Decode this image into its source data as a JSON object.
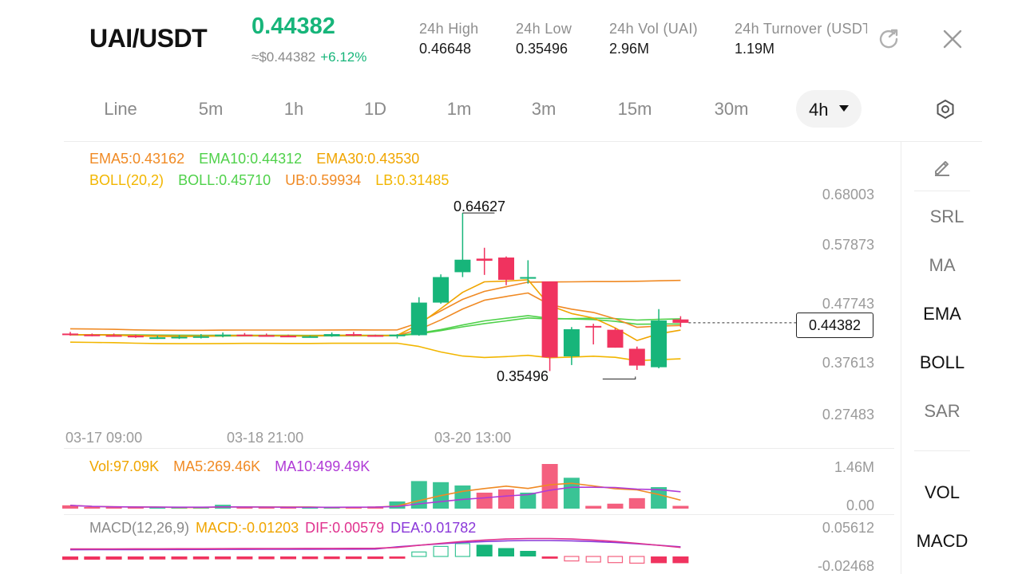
{
  "header": {
    "pair": "UAI/USDT",
    "price": "0.44382",
    "usd_price": "≈$0.44382",
    "change": "+6.12%",
    "stats": [
      {
        "label": "24h  High",
        "value": "0.46648"
      },
      {
        "label": "24h  Low",
        "value": "0.35496"
      },
      {
        "label": "24h  Vol (UAI)",
        "value": "2.96M"
      },
      {
        "label": "24h  Turnover (USDT)",
        "value": "1.19M"
      }
    ],
    "icons": [
      "share-icon",
      "close-icon"
    ]
  },
  "tabs": {
    "items": [
      "Line",
      "5m",
      "1h",
      "1D",
      "1m",
      "3m",
      "15m",
      "30m"
    ],
    "active": "4h",
    "settings_icon": "settings-icon"
  },
  "indicators": {
    "ema": {
      "ema5": "EMA5:0.43162",
      "ema10": "EMA10:0.44312",
      "ema30": "EMA30:0.43530"
    },
    "boll": {
      "name": "BOLL(20,2)",
      "mid": "BOLL:0.45710",
      "ub": "UB:0.59934",
      "lb": "LB:0.31485"
    }
  },
  "price_axis": [
    "0.68003",
    "0.57873",
    "0.47743",
    "0.37613",
    "0.27483"
  ],
  "date_axis": [
    "03-17 09:00",
    "03-18 21:00",
    "03-20 13:00"
  ],
  "annotations": {
    "high": "0.64627",
    "low": "0.35496",
    "current": "0.44382"
  },
  "volume": {
    "vol": "Vol:97.09K",
    "ma5": "MA5:269.46K",
    "ma10": "MA10:499.49K",
    "axis_top": "1.46M",
    "axis_bottom": "0.00"
  },
  "macd": {
    "name": "MACD(12,26,9)",
    "macd": "MACD:-0.01203",
    "dif": "DIF:0.00579",
    "dea": "DEA:0.01782",
    "axis_top": "0.05612",
    "axis_bottom": "-0.02468"
  },
  "side_panel": {
    "edit_icon": "pencil-icon",
    "items": [
      "SRL",
      "MA",
      "EMA",
      "BOLL",
      "SAR"
    ],
    "items2": [
      "VOL",
      "MACD"
    ]
  },
  "colors": {
    "up": "#17b57a",
    "down": "#f0335f",
    "ema5": "#f08a24",
    "ema10": "#4fd14a",
    "ema30": "#f0a500",
    "boll": "#f2b600",
    "vol_ma5": "#f08a24",
    "vol_ma10": "#b03ad6",
    "dif": "#e0338f",
    "dea": "#8a38d9"
  },
  "chart_data": {
    "type": "candlestick",
    "interval": "4h",
    "candles": [
      {
        "o": 0.424,
        "h": 0.427,
        "l": 0.42,
        "c": 0.422
      },
      {
        "o": 0.422,
        "h": 0.424,
        "l": 0.419,
        "c": 0.421
      },
      {
        "o": 0.421,
        "h": 0.424,
        "l": 0.418,
        "c": 0.42
      },
      {
        "o": 0.42,
        "h": 0.422,
        "l": 0.416,
        "c": 0.417
      },
      {
        "o": 0.417,
        "h": 0.42,
        "l": 0.414,
        "c": 0.417
      },
      {
        "o": 0.417,
        "h": 0.421,
        "l": 0.414,
        "c": 0.418
      },
      {
        "o": 0.418,
        "h": 0.423,
        "l": 0.415,
        "c": 0.419
      },
      {
        "o": 0.419,
        "h": 0.426,
        "l": 0.417,
        "c": 0.422
      },
      {
        "o": 0.422,
        "h": 0.425,
        "l": 0.419,
        "c": 0.421
      },
      {
        "o": 0.421,
        "h": 0.424,
        "l": 0.419,
        "c": 0.42
      },
      {
        "o": 0.42,
        "h": 0.422,
        "l": 0.418,
        "c": 0.419
      },
      {
        "o": 0.419,
        "h": 0.42,
        "l": 0.418,
        "c": 0.419
      },
      {
        "o": 0.419,
        "h": 0.426,
        "l": 0.418,
        "c": 0.423
      },
      {
        "o": 0.423,
        "h": 0.427,
        "l": 0.419,
        "c": 0.421
      },
      {
        "o": 0.421,
        "h": 0.422,
        "l": 0.418,
        "c": 0.419
      },
      {
        "o": 0.419,
        "h": 0.423,
        "l": 0.415,
        "c": 0.422
      },
      {
        "o": 0.421,
        "h": 0.491,
        "l": 0.42,
        "c": 0.481
      },
      {
        "o": 0.481,
        "h": 0.533,
        "l": 0.479,
        "c": 0.528
      },
      {
        "o": 0.537,
        "h": 0.646,
        "l": 0.528,
        "c": 0.56
      },
      {
        "o": 0.562,
        "h": 0.582,
        "l": 0.532,
        "c": 0.558
      },
      {
        "o": 0.564,
        "h": 0.566,
        "l": 0.513,
        "c": 0.523
      },
      {
        "o": 0.525,
        "h": 0.559,
        "l": 0.516,
        "c": 0.528
      },
      {
        "o": 0.52,
        "h": 0.52,
        "l": 0.355,
        "c": 0.38
      },
      {
        "o": 0.382,
        "h": 0.436,
        "l": 0.366,
        "c": 0.432
      },
      {
        "o": 0.438,
        "h": 0.442,
        "l": 0.404,
        "c": 0.436
      },
      {
        "o": 0.431,
        "h": 0.434,
        "l": 0.398,
        "c": 0.398
      },
      {
        "o": 0.396,
        "h": 0.4,
        "l": 0.357,
        "c": 0.365
      },
      {
        "o": 0.362,
        "h": 0.469,
        "l": 0.36,
        "c": 0.448
      },
      {
        "o": 0.45,
        "h": 0.456,
        "l": 0.436,
        "c": 0.4438
      }
    ],
    "volume": [
      0.06,
      0.02,
      0.02,
      0.02,
      0.02,
      0.02,
      0.02,
      0.07,
      0.02,
      0.02,
      0.02,
      0.02,
      0.02,
      0.03,
      0.04,
      0.13,
      0.5,
      0.48,
      0.42,
      0.29,
      0.35,
      0.29,
      0.81,
      0.56,
      0.05,
      0.09,
      0.19,
      0.39,
      0.05
    ],
    "macd_hist": [
      -0.006,
      -0.0058,
      -0.0056,
      -0.0055,
      -0.0054,
      -0.0053,
      -0.0052,
      -0.0051,
      -0.0051,
      -0.005,
      -0.0049,
      -0.0048,
      -0.0047,
      -0.0046,
      -0.0045,
      -0.004,
      0.008,
      0.018,
      0.023,
      0.021,
      0.015,
      0.01,
      -0.004,
      -0.008,
      -0.01,
      -0.011,
      -0.012,
      -0.012,
      -0.012
    ],
    "ylim": [
      0.27483,
      0.68003
    ]
  }
}
